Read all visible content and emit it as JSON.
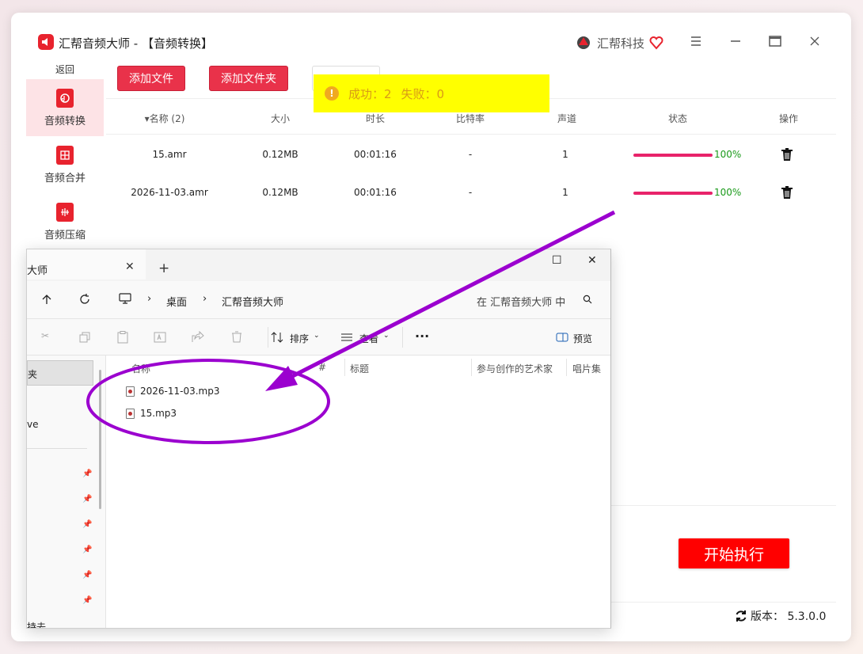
{
  "app": {
    "title": "汇帮音频大师  - 【音频转换】",
    "brand": "汇帮科技"
  },
  "sidebar": {
    "back": "返回",
    "items": [
      {
        "label": "音频转换"
      },
      {
        "label": "音频合并"
      },
      {
        "label": "音频压缩"
      }
    ]
  },
  "toolbar": {
    "add_file": "添加文件",
    "add_folder": "添加文件夹"
  },
  "toast": {
    "success": "成功：2",
    "fail": "失败：0"
  },
  "table": {
    "headers": [
      "▾名称 (2)",
      "大小",
      "时长",
      "比特率",
      "声道",
      "状态",
      "操作"
    ],
    "rows": [
      {
        "name": "15.amr",
        "size": "0.12MB",
        "duration": "00:01:16",
        "bitrate": "-",
        "channels": "1",
        "progress": 100,
        "pct": "100%"
      },
      {
        "name": "2026-11-03.amr",
        "size": "0.12MB",
        "duration": "00:01:16",
        "bitrate": "-",
        "channels": "1",
        "progress": 100,
        "pct": "100%"
      }
    ]
  },
  "actions": {
    "start": "开始执行",
    "version": "版本： 5.3.0.0"
  },
  "explorer": {
    "tab_title": "大师",
    "path": [
      "桌面",
      "汇帮音频大师"
    ],
    "search_placeholder": "在 汇帮音频大师 中",
    "commands": {
      "sort": "排序",
      "view": "查看",
      "more": "···",
      "preview": "预览"
    },
    "columns": [
      "名称",
      "#",
      "标题",
      "参与创作的艺术家",
      "唱片集"
    ],
    "files": [
      "2026-11-03.mp3",
      "15.mp3"
    ],
    "nav": {
      "first": "夹",
      "second": "ve",
      "bottom": "持去"
    }
  },
  "colors": {
    "accent_red": "#e8232e",
    "button_red": "#e9324a",
    "toast_bg": "#ffff00",
    "progress": "#e8236a",
    "annotation": "#9b00cf"
  }
}
